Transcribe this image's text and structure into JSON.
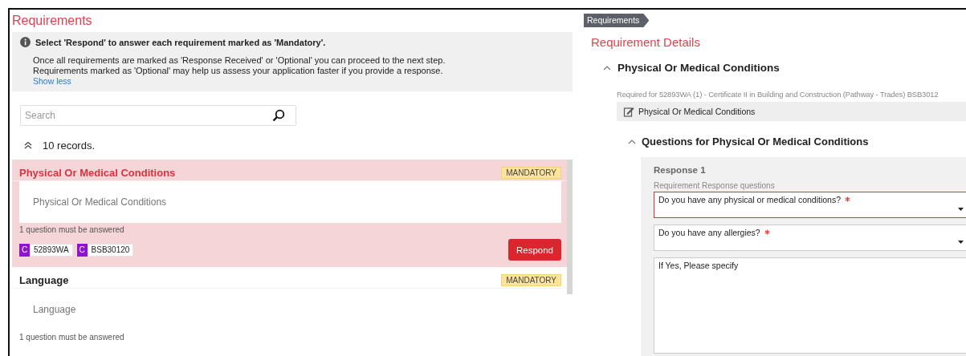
{
  "left": {
    "title": "Requirements",
    "info": {
      "heading": "Select 'Respond' to answer each requirement marked as 'Mandatory'.",
      "lines": [
        "Once all requirements are marked as 'Response Received' or 'Optional' you can proceed to the next step.",
        "Requirements marked as 'Optional' may help us assess your application faster if you provide a response."
      ],
      "link": "Show less"
    },
    "search": {
      "placeholder": "Search"
    },
    "record_count": "10 records.",
    "items": [
      {
        "title": "Physical Or Medical Conditions",
        "badge": "MANDATORY",
        "description": "Physical Or Medical Conditions",
        "note": "1 question must be answered",
        "selected": true,
        "tags": [
          {
            "letter": "C",
            "code": "52893WA"
          },
          {
            "letter": "C",
            "code": "BSB30120"
          }
        ],
        "action": "Respond"
      },
      {
        "title": "Language",
        "badge": "MANDATORY",
        "description": "Language",
        "note": "1 question must be answered",
        "selected": false
      }
    ]
  },
  "right": {
    "breadcrumb": "Requirements",
    "title": "Requirement Details",
    "section": {
      "title": "Physical Or Medical Conditions",
      "expanded": true,
      "required_for": "Required for 52893WA (1) - Certificate II in Building and Construction (Pathway - Trades) BSB3012",
      "document": "Physical Or Medical Conditions",
      "subsection": {
        "title": "Questions for Physical Or Medical Conditions",
        "expanded": true,
        "response": {
          "title": "Response 1",
          "subtitle": "Requirement Response questions",
          "fields": [
            {
              "kind": "select",
              "label": "Do you have any physical or medical conditions?",
              "required": true,
              "invalid": true
            },
            {
              "kind": "select",
              "label": "Do you have any allergies?",
              "required": true,
              "invalid": false
            },
            {
              "kind": "textarea",
              "label": "If Yes, Please specify",
              "required": false,
              "invalid": false
            }
          ]
        }
      }
    }
  }
}
